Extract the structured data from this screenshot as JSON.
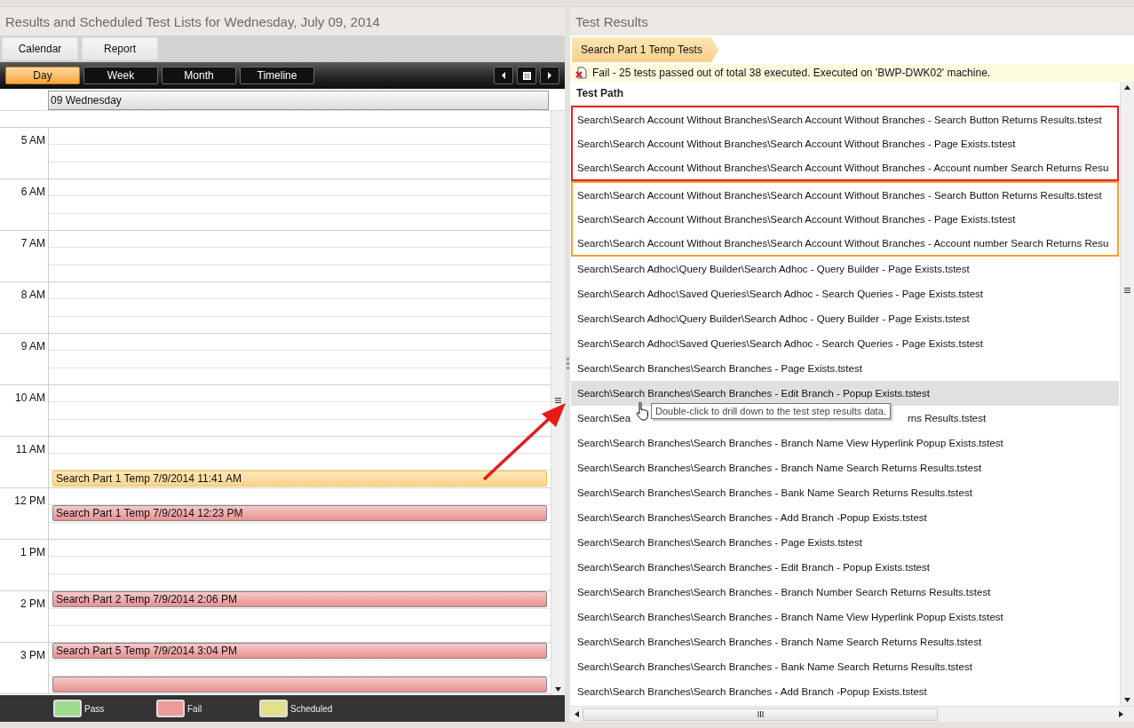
{
  "calendar_panel": {
    "title": "Results and Scheduled Test Lists for Wednesday, July 09, 2014",
    "mode_buttons": [
      {
        "label": "Calendar"
      },
      {
        "label": "Report"
      }
    ],
    "view_tabs": [
      {
        "label": "Day",
        "selected": true
      },
      {
        "label": "Week",
        "selected": false
      },
      {
        "label": "Month",
        "selected": false
      },
      {
        "label": "Timeline",
        "selected": false
      }
    ],
    "day_header": "09 Wednesday",
    "hours": [
      {
        "label": "5 AM"
      },
      {
        "label": "6 AM"
      },
      {
        "label": "7 AM"
      },
      {
        "label": "8 AM"
      },
      {
        "label": "9 AM"
      },
      {
        "label": "10 AM"
      },
      {
        "label": "11 AM",
        "third": [
          {
            "title": "Search Part 1 Temp 7/9/2014 11:41 AM",
            "kind": "fail",
            "selected": true
          }
        ]
      },
      {
        "label": "12 PM",
        "second": [
          {
            "title": "Search Part 1 Temp 7/9/2014 12:23 PM",
            "kind": "fail",
            "selected": false
          }
        ]
      },
      {
        "label": "1 PM"
      },
      {
        "label": "2 PM",
        "first": [
          {
            "title": "Search Part 2 Temp 7/9/2014 2:06 PM",
            "kind": "fail",
            "selected": false
          }
        ]
      },
      {
        "label": "3 PM",
        "first": [
          {
            "title": "Search Part 5 Temp 7/9/2014 3:04 PM",
            "kind": "fail",
            "selected": false
          }
        ],
        "third": [
          {
            "kind": "fail",
            "selected": false
          }
        ]
      }
    ],
    "legend": [
      {
        "label": "Pass",
        "color": "#9fdc8c"
      },
      {
        "label": "Fail",
        "color": "#ec9a9a"
      },
      {
        "label": "Scheduled",
        "color": "#e3df8c"
      }
    ]
  },
  "results_panel": {
    "title": "Test Results",
    "breadcrumb": "Search Part 1 Temp Tests",
    "summary": {
      "kind": "fail",
      "text": "Fail - 25 tests passed out of total 38 executed. Executed on 'BWP-DWK02' machine."
    },
    "column": "Test Path",
    "row_groups": [
      {
        "color": "#e8202a",
        "rows": [
          {
            "path": "Search\\Search Account Without Branches\\Search Account Without Branches - Search Button Returns Results.tstest",
            "selected": false
          },
          {
            "path": "Search\\Search Account Without Branches\\Search Account Without Branches - Page Exists.tstest",
            "selected": false
          },
          {
            "path": "Search\\Search Account Without Branches\\Search Account Without Branches - Account number Search Returns Resu",
            "selected": false
          }
        ]
      },
      {
        "color": "#f0a030",
        "rows": [
          {
            "path": "Search\\Search Account Without Branches\\Search Account Without Branches - Search Button Returns Results.tstest",
            "selected": false
          },
          {
            "path": "Search\\Search Account Without Branches\\Search Account Without Branches - Page Exists.tstest",
            "selected": false
          },
          {
            "path": "Search\\Search Account Without Branches\\Search Account Without Branches - Account number Search Returns Resu",
            "selected": false
          }
        ]
      },
      {
        "rows": [
          {
            "path": "Search\\Search Adhoc\\Query Builder\\Search Adhoc - Query Builder - Page Exists.tstest",
            "selected": false
          },
          {
            "path": "Search\\Search Adhoc\\Saved Queries\\Search Adhoc - Search Queries - Page Exists.tstest",
            "selected": false
          },
          {
            "path": "Search\\Search Adhoc\\Query Builder\\Search Adhoc - Query Builder - Page Exists.tstest",
            "selected": false
          },
          {
            "path": "Search\\Search Adhoc\\Saved Queries\\Search Adhoc - Search Queries - Page Exists.tstest",
            "selected": false
          },
          {
            "path": "Search\\Search Branches\\Search Branches - Page Exists.tstest",
            "selected": false
          },
          {
            "path": "Search\\Search Branches\\Search Branches - Edit Branch - Popup Exists.tstest",
            "selected": true
          },
          {
            "path": "Search\\Sea",
            "path_end": "rns Results.tstest",
            "selected": false
          },
          {
            "path": "Search\\Search Branches\\Search Branches - Branch Name View Hyperlink Popup Exists.tstest",
            "selected": false
          },
          {
            "path": "Search\\Search Branches\\Search Branches - Branch Name Search Returns Results.tstest",
            "selected": false
          },
          {
            "path": "Search\\Search Branches\\Search Branches - Bank Name Search Returns Results.tstest",
            "selected": false
          },
          {
            "path": "Search\\Search Branches\\Search Branches - Add Branch -Popup Exists.tstest",
            "selected": false
          },
          {
            "path": "Search\\Search Branches\\Search Branches - Page Exists.tstest",
            "selected": false
          },
          {
            "path": "Search\\Search Branches\\Search Branches - Edit Branch - Popup Exists.tstest",
            "selected": false
          },
          {
            "path": "Search\\Search Branches\\Search Branches - Branch Number Search Returns Results.tstest",
            "selected": false
          },
          {
            "path": "Search\\Search Branches\\Search Branches - Branch Name View Hyperlink Popup Exists.tstest",
            "selected": false
          },
          {
            "path": "Search\\Search Branches\\Search Branches - Branch Name Search Returns Results.tstest",
            "selected": false
          },
          {
            "path": "Search\\Search Branches\\Search Branches - Bank Name Search Returns Results.tstest",
            "selected": false
          },
          {
            "path": "Search\\Search Branches\\Search Branches - Add Branch -Popup Exists.tstest",
            "selected": false
          }
        ]
      }
    ],
    "tooltip": "Double-click to drill down to the test step results data."
  }
}
